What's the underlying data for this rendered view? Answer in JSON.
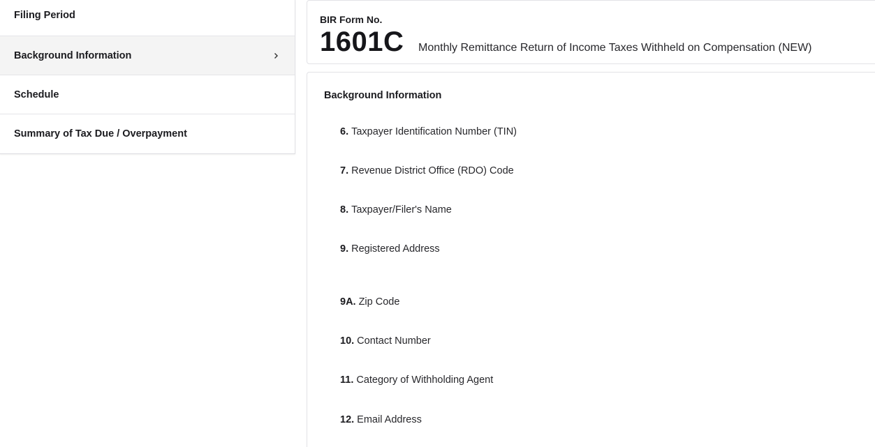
{
  "sidebar": {
    "items": [
      {
        "label": "Filing Period"
      },
      {
        "label": "Background Information"
      },
      {
        "label": "Schedule"
      },
      {
        "label": "Summary of Tax Due / Overpayment"
      }
    ]
  },
  "form_header": {
    "label": "BIR Form No.",
    "number": "1601C",
    "title": "Monthly Remittance Return of Income Taxes Withheld on Compensation (NEW)"
  },
  "section": {
    "title": "Background Information",
    "fields": [
      {
        "num": "6.",
        "label": "Taxpayer Identification Number (TIN)"
      },
      {
        "num": "7.",
        "label": "Revenue District Office (RDO) Code"
      },
      {
        "num": "8.",
        "label": "Taxpayer/Filer's Name"
      },
      {
        "num": "9.",
        "label": "Registered Address"
      },
      {
        "num": "9A.",
        "label": "Zip Code"
      },
      {
        "num": "10.",
        "label": "Contact Number"
      },
      {
        "num": "11.",
        "label": "Category of Withholding Agent"
      },
      {
        "num": "12.",
        "label": "Email Address"
      }
    ]
  }
}
